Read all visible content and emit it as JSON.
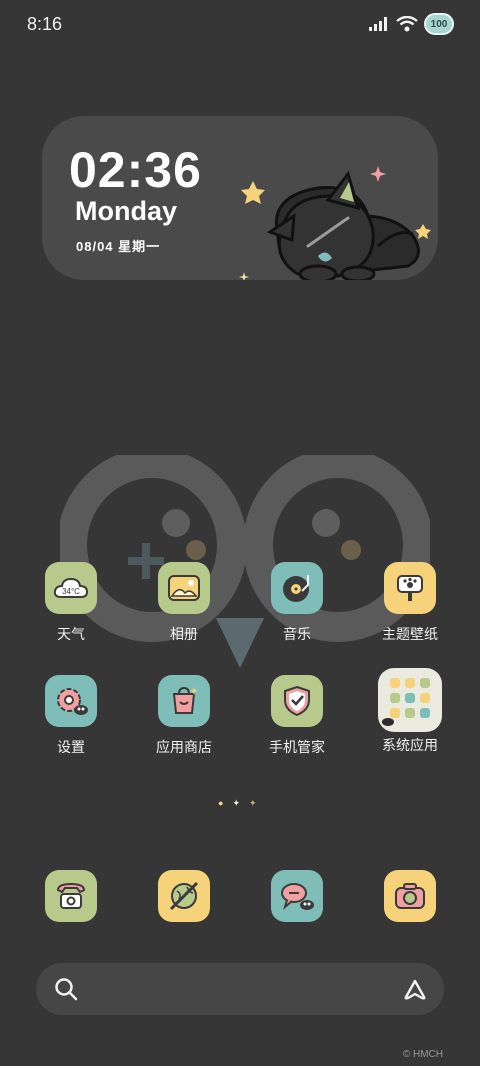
{
  "status_bar": {
    "time": "8:16",
    "battery": "100",
    "icons": [
      "signal-icon",
      "wifi-icon",
      "battery-icon"
    ]
  },
  "widget": {
    "time": "02:36",
    "day": "Monday",
    "date": "08/04  星期一"
  },
  "apps": [
    {
      "label": "天气",
      "icon": "weather-icon",
      "color": "#b8c98c",
      "badge": "34°C"
    },
    {
      "label": "相册",
      "icon": "gallery-icon",
      "color": "#b8c98c"
    },
    {
      "label": "音乐",
      "icon": "music-icon",
      "color": "#7fbdb8"
    },
    {
      "label": "主题壁纸",
      "icon": "theme-icon",
      "color": "#f6d27a"
    },
    {
      "label": "设置",
      "icon": "settings-icon",
      "color": "#7fbdb8"
    },
    {
      "label": "应用商店",
      "icon": "app-store-icon",
      "color": "#7fbdb8"
    },
    {
      "label": "手机管家",
      "icon": "security-icon",
      "color": "#b8c98c"
    },
    {
      "label": "系统应用",
      "icon": "system-apps-folder-icon",
      "color": "#ebeadf"
    }
  ],
  "dock": [
    {
      "name": "phone",
      "icon": "phone-icon",
      "color": "#b8c98c"
    },
    {
      "name": "browser",
      "icon": "browser-icon",
      "color": "#f6d27a"
    },
    {
      "name": "messages",
      "icon": "messages-icon",
      "color": "#7fbdb8"
    },
    {
      "name": "camera",
      "icon": "camera-icon",
      "color": "#f6d27a"
    }
  ],
  "search": {
    "icon": "search-icon",
    "assistant_icon": "assistant-icon"
  },
  "watermark": "© HMCH"
}
